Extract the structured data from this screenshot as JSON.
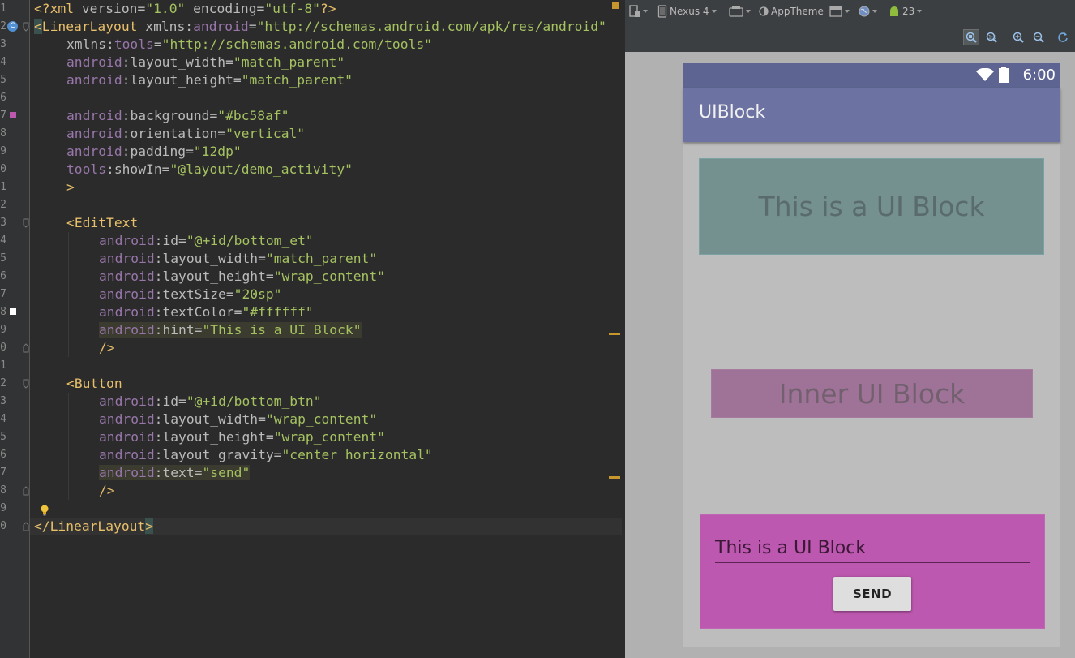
{
  "editor": {
    "line_numbers": [
      "1",
      "2",
      "3",
      "4",
      "5",
      "6",
      "7",
      "8",
      "9",
      "0",
      "1",
      "2",
      "3",
      "4",
      "5",
      "6",
      "7",
      "8",
      "9",
      "0",
      "1",
      "2",
      "3",
      "4",
      "5",
      "6",
      "7",
      "8",
      "9",
      "0"
    ],
    "lines": {
      "l1": {
        "open": "<?",
        "tag": "xml",
        "sp1": " ",
        "a1": "version",
        "eq1": "=",
        "v1": "\"1.0\"",
        "sp2": " ",
        "a2": "encoding",
        "eq2": "=",
        "v2": "\"utf-8\"",
        "close": "?>"
      },
      "l2": {
        "open": "<",
        "tag": "LinearLayout",
        "sp": " ",
        "ns1": "xmlns",
        "colon": ":",
        "ns2": "android",
        "eq": "=",
        "val": "\"http://schemas.android.com/apk/res/android\""
      },
      "l3": {
        "ns1": "xmlns",
        "colon": ":",
        "ns2": "tools",
        "eq": "=",
        "val": "\"http://schemas.android.com/tools\""
      },
      "l4": {
        "ns": "android",
        "colon": ":",
        "attr": "layout_width",
        "eq": "=",
        "val": "\"match_parent\""
      },
      "l5": {
        "ns": "android",
        "colon": ":",
        "attr": "layout_height",
        "eq": "=",
        "val": "\"match_parent\""
      },
      "l7": {
        "ns": "android",
        "colon": ":",
        "attr": "background",
        "eq": "=",
        "val": "\"#bc58af\""
      },
      "l8": {
        "ns": "android",
        "colon": ":",
        "attr": "orientation",
        "eq": "=",
        "val": "\"vertical\""
      },
      "l9": {
        "ns": "android",
        "colon": ":",
        "attr": "padding",
        "eq": "=",
        "val": "\"12dp\""
      },
      "l10": {
        "ns": "tools",
        "colon": ":",
        "attr": "showIn",
        "eq": "=",
        "val": "\"@layout/demo_activity\""
      },
      "l11": {
        "close": ">"
      },
      "l13": {
        "open": "<",
        "tag": "EditText"
      },
      "l14": {
        "ns": "android",
        "colon": ":",
        "attr": "id",
        "eq": "=",
        "val": "\"@+id/bottom_et\""
      },
      "l15": {
        "ns": "android",
        "colon": ":",
        "attr": "layout_width",
        "eq": "=",
        "val": "\"match_parent\""
      },
      "l16": {
        "ns": "android",
        "colon": ":",
        "attr": "layout_height",
        "eq": "=",
        "val": "\"wrap_content\""
      },
      "l17": {
        "ns": "android",
        "colon": ":",
        "attr": "textSize",
        "eq": "=",
        "val": "\"20sp\""
      },
      "l18": {
        "ns": "android",
        "colon": ":",
        "attr": "textColor",
        "eq": "=",
        "val": "\"#ffffff\""
      },
      "l19": {
        "ns": "android",
        "colon": ":",
        "attr": "hint",
        "eq": "=",
        "val": "\"This is a UI Block\""
      },
      "l20": {
        "close": "/>"
      },
      "l22": {
        "open": "<",
        "tag": "Button"
      },
      "l23": {
        "ns": "android",
        "colon": ":",
        "attr": "id",
        "eq": "=",
        "val": "\"@+id/bottom_btn\""
      },
      "l24": {
        "ns": "android",
        "colon": ":",
        "attr": "layout_width",
        "eq": "=",
        "val": "\"wrap_content\""
      },
      "l25": {
        "ns": "android",
        "colon": ":",
        "attr": "layout_height",
        "eq": "=",
        "val": "\"wrap_content\""
      },
      "l26": {
        "ns": "android",
        "colon": ":",
        "attr": "layout_gravity",
        "eq": "=",
        "val": "\"center_horizontal\""
      },
      "l27": {
        "ns": "android",
        "colon": ":",
        "attr": "text",
        "eq": "=",
        "val": "\"send\""
      },
      "l28": {
        "close": "/>"
      },
      "l30": {
        "open": "</",
        "tag": "LinearLayout",
        "close": ">"
      }
    },
    "gutter_badge": "C",
    "colors": {
      "background_swatch": "#bc58af",
      "text_swatch": "#ffffff",
      "bg": "#2b2b2b",
      "tag": "#e8bf6a",
      "ns": "#9876aa",
      "value": "#a5c261"
    }
  },
  "toolbar": {
    "layout_icon": "layout-variant-icon",
    "device_label": "Nexus 4",
    "orientation_icon": "orientation-icon",
    "theme_label": "AppTheme",
    "activity_icon": "activity-icon",
    "locale_icon": "globe-icon",
    "api_label": "23",
    "zoom_icons": [
      "zoom-fit-icon",
      "zoom-actual-icon",
      "zoom-in-icon",
      "zoom-out-icon",
      "refresh-icon"
    ]
  },
  "device": {
    "time": "6:00",
    "app_title": "UIBlock",
    "block1_text": "This is a UI Block",
    "block2_text": "Inner UI Block",
    "edittext_text": "This is a UI Block",
    "button_text": "SEND",
    "colors": {
      "statusbar": "#5d6491",
      "appbar": "#6c72a1",
      "block3": "#bc58af"
    }
  }
}
